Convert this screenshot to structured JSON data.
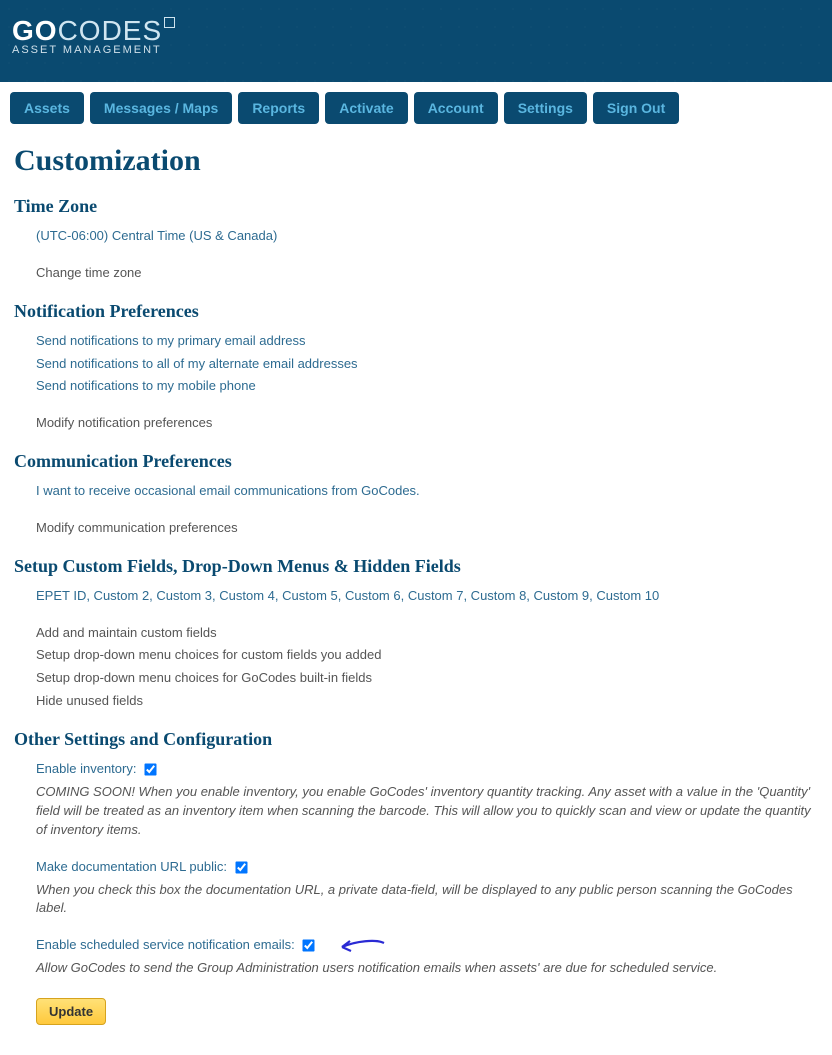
{
  "header": {
    "logo_primary": "GO",
    "logo_secondary": "CODES",
    "sublogo": "ASSET MANAGEMENT"
  },
  "nav": {
    "items": [
      "Assets",
      "Messages / Maps",
      "Reports",
      "Activate",
      "Account",
      "Settings",
      "Sign Out"
    ]
  },
  "page": {
    "title": "Customization"
  },
  "timezone": {
    "heading": "Time Zone",
    "value": "(UTC-06:00) Central Time (US & Canada)",
    "change_link": "Change time zone"
  },
  "notifications": {
    "heading": "Notification Preferences",
    "items": [
      "Send notifications to my primary email address",
      "Send notifications to all of my alternate email addresses",
      "Send notifications to my mobile phone"
    ],
    "modify_link": "Modify notification preferences"
  },
  "communication": {
    "heading": "Communication Preferences",
    "item": "I want to receive occasional email communications from GoCodes.",
    "modify_link": "Modify communication preferences"
  },
  "customfields": {
    "heading": "Setup Custom Fields, Drop-Down Menus & Hidden Fields",
    "list": "EPET ID, Custom 2, Custom 3, Custom 4, Custom 5, Custom 6, Custom 7, Custom 8, Custom 9, Custom 10",
    "links": [
      "Add and maintain custom fields",
      "Setup drop-down menu choices for custom fields you added",
      "Setup drop-down menu choices for GoCodes built-in fields",
      "Hide unused fields"
    ]
  },
  "other": {
    "heading": "Other Settings and Configuration",
    "inventory_label": "Enable inventory:",
    "inventory_checked": true,
    "inventory_desc": "COMING SOON! When you enable inventory, you enable GoCodes' inventory quantity tracking. Any asset with a value in the 'Quantity' field will be treated as an inventory item when scanning the barcode. This will allow you to quickly scan and view or update the quantity of inventory items.",
    "docurl_label": "Make documentation URL public:",
    "docurl_checked": true,
    "docurl_desc": "When you check this box the documentation URL, a private data-field, will be displayed to any public person scanning the GoCodes label.",
    "service_label": "Enable scheduled service notification emails:",
    "service_checked": true,
    "service_desc": "Allow GoCodes to send the Group Administration users notification emails when assets' are due for scheduled service.",
    "update_button": "Update"
  }
}
